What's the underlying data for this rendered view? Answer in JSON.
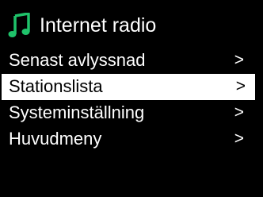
{
  "header": {
    "icon": "music-note-icon",
    "icon_color": "#1fc26a",
    "title": "Internet radio"
  },
  "menu": {
    "items": [
      {
        "label": "Senast avlyssnad",
        "arrow": ">"
      },
      {
        "label": "Stationslista",
        "arrow": ">"
      },
      {
        "label": "Systeminställning",
        "arrow": ">"
      },
      {
        "label": "Huvudmeny",
        "arrow": ">"
      }
    ],
    "selected_index": 1
  },
  "colors": {
    "background": "#000000",
    "text": "#ffffff",
    "highlight_bg": "#ffffff",
    "highlight_text": "#000000"
  }
}
